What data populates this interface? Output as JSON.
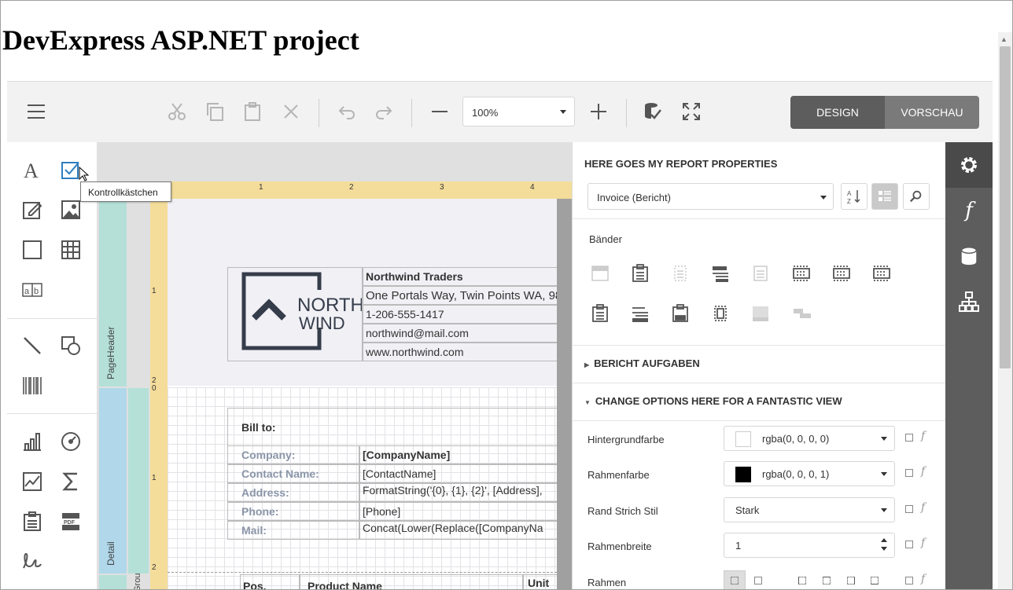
{
  "page": {
    "title": "DevExpress ASP.NET project"
  },
  "toolbar": {
    "zoom_value": "100%",
    "design_label": "DESIGN",
    "preview_label": "VORSCHAU"
  },
  "toolbox": {
    "tooltip": "Kontrollkästchen"
  },
  "surface": {
    "ruler_numbers": [
      "1",
      "2",
      "3",
      "4"
    ],
    "vruler_numbers": [
      "1",
      "2",
      "0",
      "1",
      "2"
    ],
    "bands": {
      "page_header": "PageHeader",
      "detail": "Detail",
      "group": "Grou"
    },
    "logo": {
      "line1": "NORTH",
      "line2": "WIND"
    },
    "company": {
      "name": "Northwind Traders",
      "address": "One Portals Way, Twin Points WA, 98",
      "phone": "1-206-555-1417",
      "email": "northwind@mail.com",
      "web": "www.northwind.com"
    },
    "bill_to": "Bill to:",
    "fields": [
      {
        "label": "Company:",
        "value": "[CompanyName]"
      },
      {
        "label": "Contact Name:",
        "value": "[ContactName]"
      },
      {
        "label": "Address:",
        "value": "FormatString('{0}, {1}, {2}', [Address],"
      },
      {
        "label": "Phone:",
        "value": "[Phone]"
      },
      {
        "label": "Mail:",
        "value": "Concat(Lower(Replace([CompanyNa"
      }
    ],
    "table_headers": [
      "Pos.",
      "Product Name",
      "Unit"
    ]
  },
  "properties": {
    "header": "HERE GOES MY REPORT PROPERTIES",
    "selected_report": "Invoice (Bericht)",
    "bands_title": "Bänder",
    "section_tasks": "BERICHT AUFGABEN",
    "section_options": "CHANGE OPTIONS HERE FOR A FANTASTIC VIEW",
    "rows": [
      {
        "label": "Hintergrundfarbe",
        "value": "rgba(0, 0, 0, 0)",
        "swatch": "#ffffff"
      },
      {
        "label": "Rahmenfarbe",
        "value": "rgba(0, 0, 0, 1)",
        "swatch": "#000000"
      },
      {
        "label": "Rand Strich Stil",
        "value": "Stark"
      },
      {
        "label": "Rahmenbreite",
        "value": "1"
      },
      {
        "label": "Rahmen",
        "value": ""
      }
    ]
  },
  "colors": {
    "accent": "#2f7fc1",
    "ruler": "#f4dd9a",
    "page_header_band": "#b4e0d8",
    "detail_band": "#b0d8ea",
    "dark_tab_bg": "#5d5d5d",
    "logo_color": "#353c4a"
  }
}
